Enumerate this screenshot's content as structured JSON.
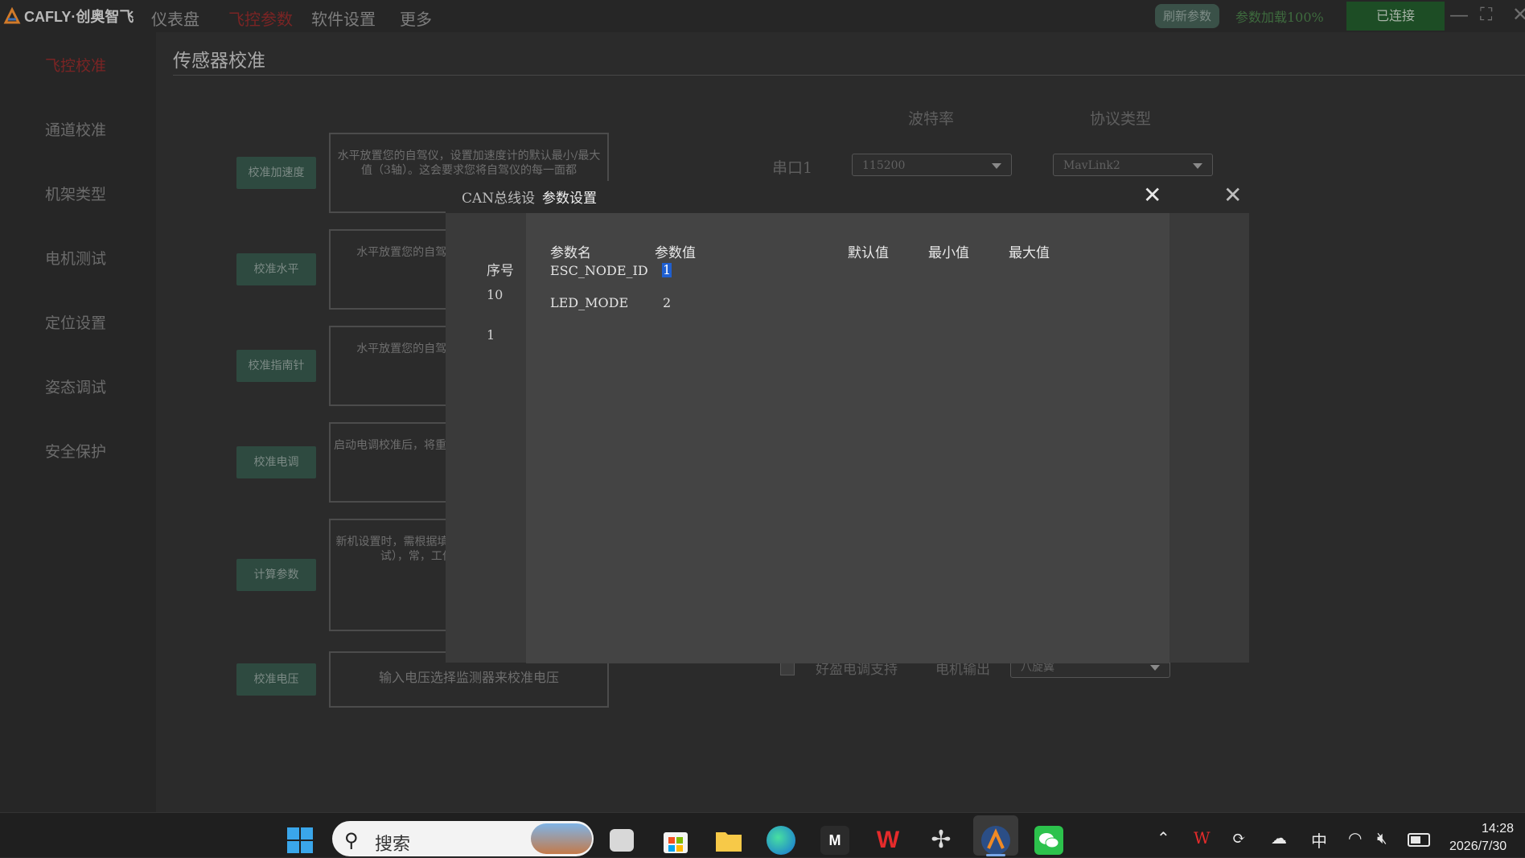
{
  "app": {
    "brand": "CAFLY·创奥智飞"
  },
  "nav": {
    "items": [
      {
        "label": "仪表盘"
      },
      {
        "label": "飞控参数"
      },
      {
        "label": "软件设置"
      },
      {
        "label": "更多"
      }
    ]
  },
  "top_right": {
    "refresh_label": "刷新参数",
    "load_status": "参数加载100%",
    "connection": "已连接"
  },
  "sidebar": {
    "items": [
      {
        "label": "飞控校准"
      },
      {
        "label": "通道校准"
      },
      {
        "label": "机架类型"
      },
      {
        "label": "电机测试"
      },
      {
        "label": "定位设置"
      },
      {
        "label": "姿态调试"
      },
      {
        "label": "安全保护"
      }
    ]
  },
  "page": {
    "title": "传感器校准"
  },
  "calibration": [
    {
      "button": "校准加速度",
      "text": "水平放置您的自驾仪，设置加速度计的默认最小/最大值（3轴）。这会要求您将自驾仪的每一面都"
    },
    {
      "button": "校准水平",
      "text": "水平放置您的自驾仪（1轴/航姿系统平衡在水"
    },
    {
      "button": "校准指南针",
      "text": "水平放置您的自驾仪（1轴/航姿系统平衡在水"
    },
    {
      "button": "校准电调",
      "text": "启动电调校准后，将重新上电，飞控会自行程类电调需要校准调"
    },
    {
      "button": "计算参数",
      "text": "新机设置时，需根据填写前请确认：1、机架、电机测试），常，工作说明：INS20，小机"
    },
    {
      "button": "校准电压",
      "text": "输入电压选择监测器来校准电压"
    }
  ],
  "serial": {
    "baud_header": "波特率",
    "protocol_header": "协议类型",
    "port_label": "串口1",
    "baud_value": "115200",
    "protocol_value": "MavLink2"
  },
  "lower": {
    "checkbox_label": "好盈电调支持",
    "motor_output_label": "电机输出",
    "motor_output_value": "八旋翼"
  },
  "dialog": {
    "tabs": [
      "CAN总线设",
      "参数设置"
    ],
    "index_header": "序号",
    "indices": [
      "10",
      "1"
    ],
    "columns": [
      "参数名",
      "参数值",
      "默认值",
      "最小值",
      "最大值"
    ],
    "rows": [
      {
        "name": "ESC_NODE_ID",
        "value": "1"
      },
      {
        "name": "LED_MODE",
        "value": "2"
      }
    ]
  },
  "taskbar": {
    "search_placeholder": "搜索",
    "time": "14:28",
    "date": "2026/7/30",
    "ime": "中",
    "icons": [
      "windows-start-icon",
      "task-view-icon",
      "store-icon",
      "file-explorer-icon",
      "edge-icon",
      "mp-app-icon",
      "wps-icon",
      "drone-app-icon",
      "cafly-app-icon",
      "wechat-icon"
    ]
  },
  "colors": {
    "accent_red": "#7a2424",
    "connected_green": "#1d4d25",
    "button_teal": "#2e4a40"
  }
}
